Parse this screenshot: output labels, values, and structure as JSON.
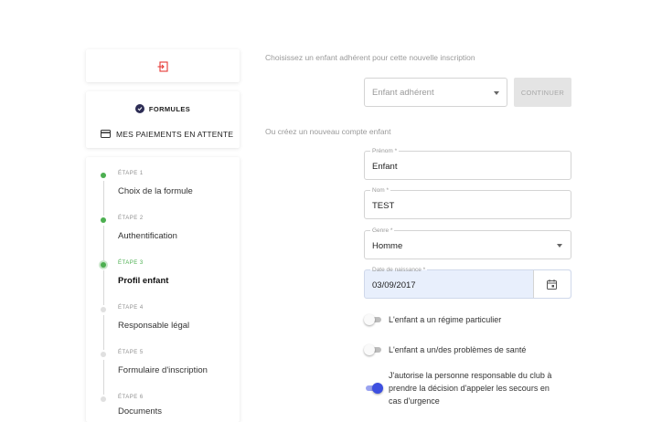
{
  "sidebar": {
    "menu": {
      "formules_label": "FORMULES",
      "paiements_label": "MES PAIEMENTS EN ATTENTE"
    },
    "steps": [
      {
        "num": "ÉTAPE 1",
        "title": "Choix de la formule",
        "state": "done"
      },
      {
        "num": "ÉTAPE 2",
        "title": "Authentification",
        "state": "done"
      },
      {
        "num": "ÉTAPE 3",
        "title": "Profil enfant",
        "state": "active"
      },
      {
        "num": "ÉTAPE 4",
        "title": "Responsable légal",
        "state": "pending"
      },
      {
        "num": "ÉTAPE 5",
        "title": "Formulaire d'inscription",
        "state": "pending"
      },
      {
        "num": "ÉTAPE 6",
        "title": "Documents",
        "state": "pending"
      }
    ]
  },
  "main": {
    "choose_hint": "Choisissez un enfant adhérent pour cette nouvelle inscription",
    "child_select_value": "Enfant adhérent",
    "continue_label": "CONTINUER",
    "create_hint": "Ou créez un nouveau compte enfant",
    "fields": {
      "prenom": {
        "label": "Prénom *",
        "value": "Enfant"
      },
      "nom": {
        "label": "Nom *",
        "value": "TEST"
      },
      "genre": {
        "label": "Genre *",
        "value": "Homme"
      },
      "date": {
        "label": "Date de naissance *",
        "value": "03/09/2017"
      }
    },
    "toggles": [
      {
        "label": "L'enfant a un régime particulier",
        "on": false
      },
      {
        "label": "L'enfant a un/des problèmes de santé",
        "on": false
      },
      {
        "label": "J'autorise la personne responsable du club à prendre la décision d'appeler les secours en cas d'urgence",
        "on": true
      }
    ]
  },
  "colors": {
    "step_done": "#4caf50",
    "step_pending": "#dddddd",
    "toggle_on": "#3d4fe0",
    "logout_icon": "#e53935"
  },
  "icons": [
    "logout-icon",
    "check-circle-icon",
    "credit-card-icon",
    "calendar-icon",
    "chevron-down-icon"
  ]
}
